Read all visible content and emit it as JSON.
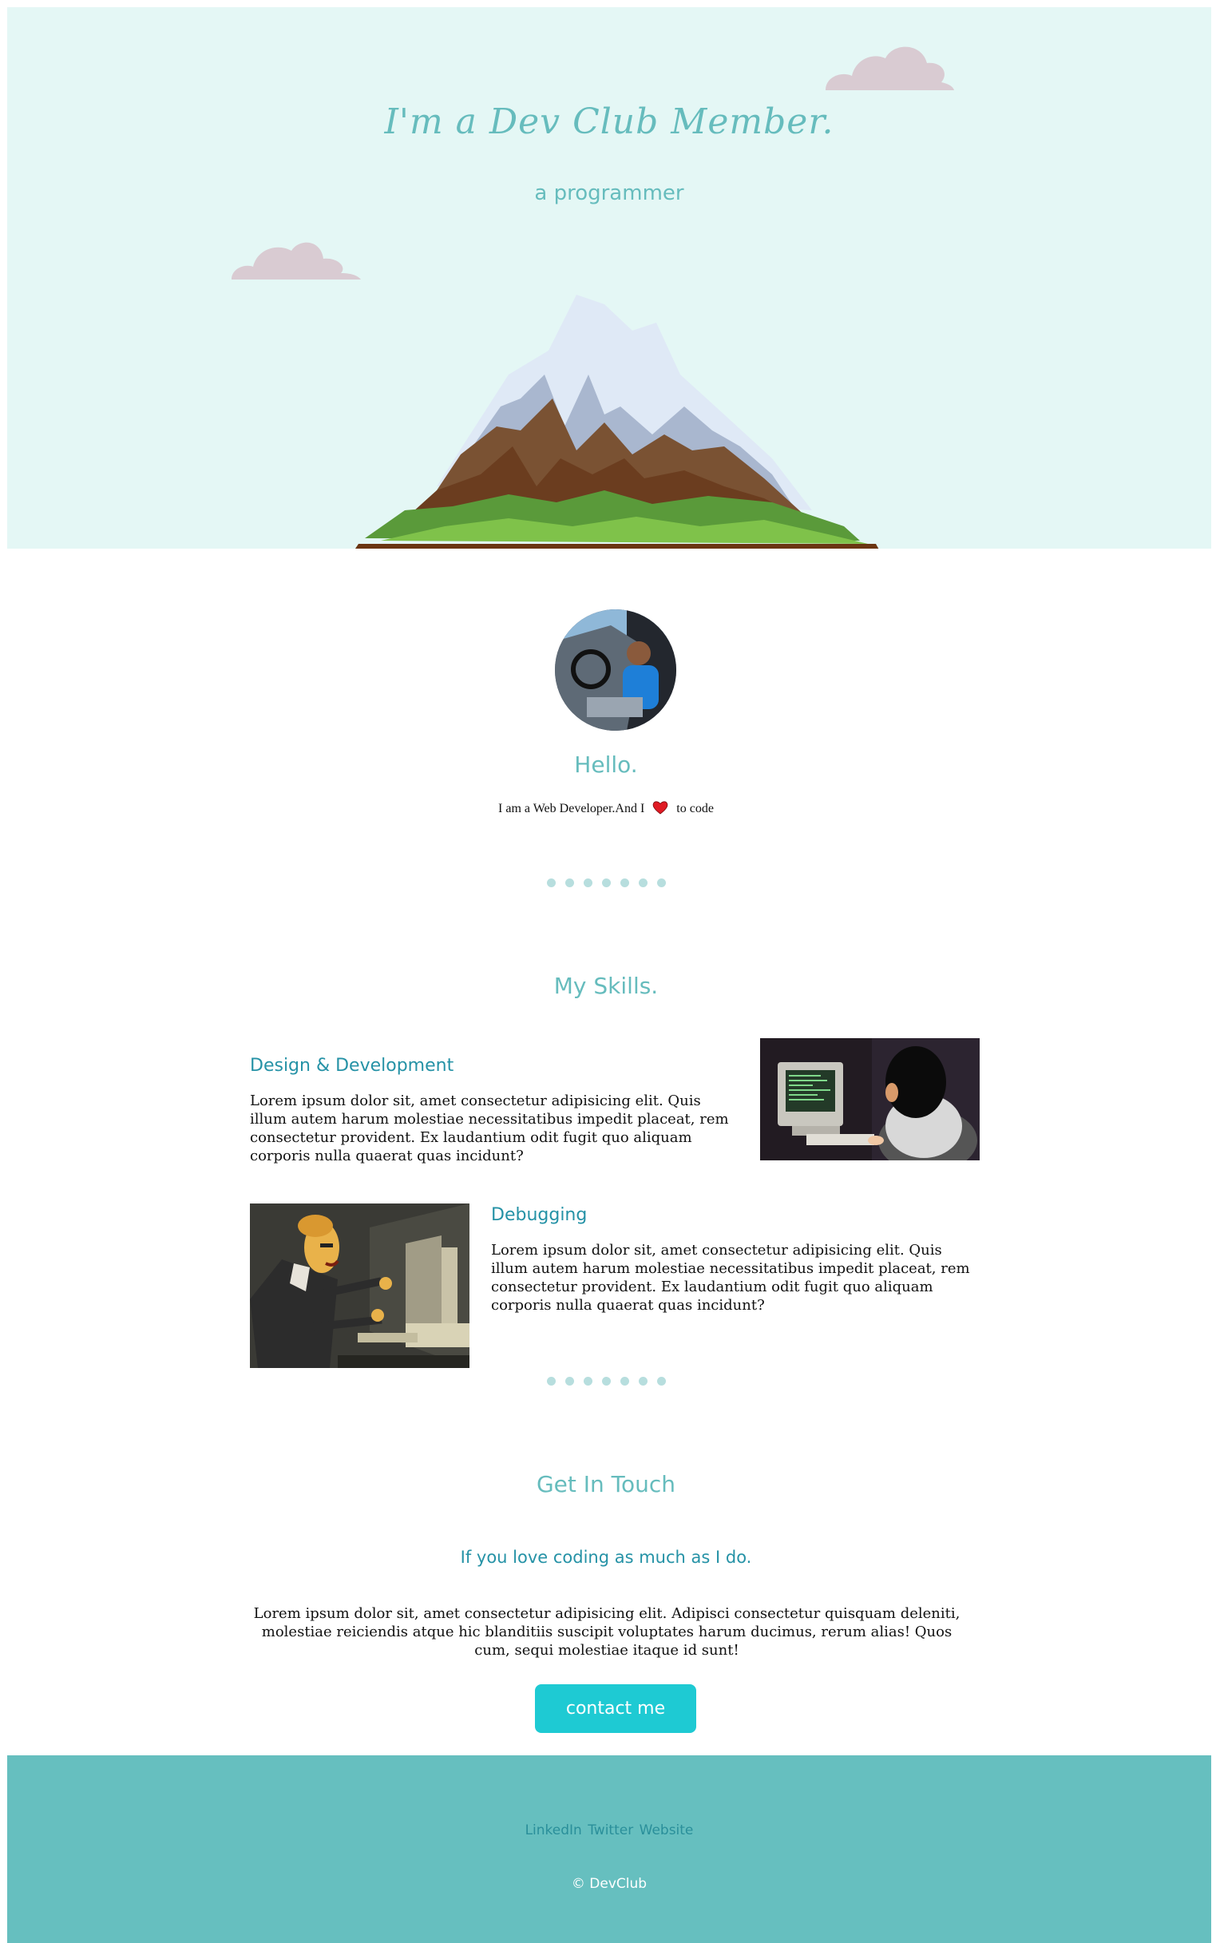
{
  "hero": {
    "title": "I'm a Dev Club Member.",
    "subtitle": "a programmer"
  },
  "profile": {
    "heading": "Hello.",
    "intro_before": "I am a Web Developer.And I",
    "intro_after": "to code"
  },
  "skills": {
    "title": "My Skills.",
    "items": [
      {
        "heading": "Design & Development",
        "text": "Lorem ipsum dolor sit, amet consectetur adipisicing elit. Quis illum autem harum molestiae necessitatibus impedit placeat, rem consectetur provident. Ex laudantium odit fugit quo aliquam corporis nulla quaerat quas incidunt?"
      },
      {
        "heading": "Debugging",
        "text": "Lorem ipsum dolor sit, amet consectetur adipisicing elit. Quis illum autem harum molestiae necessitatibus impedit placeat, rem consectetur provident. Ex laudantium odit fugit quo aliquam corporis nulla quaerat quas incidunt?"
      }
    ]
  },
  "contact": {
    "title": "Get In Touch",
    "subtitle": "If you love coding as much as I do.",
    "text": "Lorem ipsum dolor sit, amet consectetur adipisicing elit. Adipisci consectetur quisquam deleniti, molestiae reiciendis atque hic blanditiis suscipit voluptates harum ducimus, rerum alias! Quos cum, sequi molestiae itaque id sunt!",
    "button_label": "contact me"
  },
  "footer": {
    "links": [
      "LinkedIn",
      "Twitter",
      "Website"
    ],
    "copyright": "© DevClub"
  },
  "colors": {
    "hero_bg": "#e4f7f5",
    "accent": "#66bcbd",
    "button": "#1ecad3",
    "footer_bg": "#66bfbf",
    "cloud": "#d9cbd2"
  }
}
